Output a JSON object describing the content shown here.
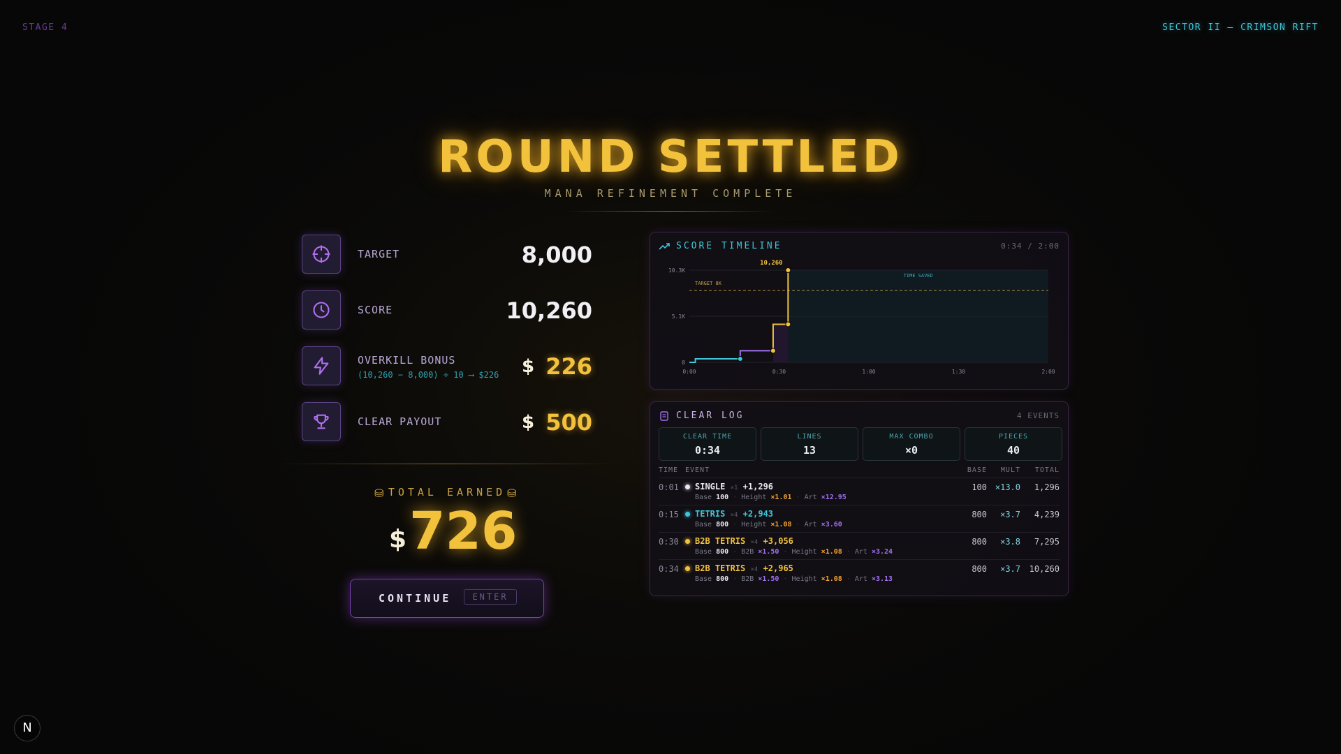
{
  "header": {
    "stage": "STAGE 4",
    "sector": "SECTOR II — CRIMSON RIFT"
  },
  "title": "ROUND SETTLED",
  "subtitle": "MANA REFINEMENT COMPLETE",
  "stats": {
    "target": {
      "label": "TARGET",
      "value": "8,000",
      "icon": "crosshair-icon"
    },
    "score": {
      "label": "SCORE",
      "value": "10,260",
      "icon": "clock-icon"
    },
    "overkill": {
      "label": "OVERKILL BONUS",
      "formula": "(10,260 − 8,000) ÷ 10 ⟶ $226",
      "currency": "$",
      "value": "226",
      "icon": "lightning-icon"
    },
    "payout": {
      "label": "CLEAR PAYOUT",
      "currency": "$",
      "value": "500",
      "icon": "trophy-icon"
    }
  },
  "total": {
    "label": "TOTAL EARNED",
    "currency": "$",
    "value": "726"
  },
  "continue": {
    "label": "CONTINUE",
    "key": "ENTER"
  },
  "timeline": {
    "title": "SCORE TIMELINE",
    "time": "0:34 / 2:00",
    "chart_data": {
      "type": "line",
      "x": [
        0,
        4,
        4,
        34,
        34,
        56,
        56,
        66,
        66
      ],
      "y": [
        0,
        0,
        384,
        384,
        1296,
        1296,
        4239,
        4239,
        10260
      ],
      "xticks": [
        "0:00",
        "0:30",
        "1:00",
        "1:30",
        "2:00"
      ],
      "yticks": [
        "0",
        "5.1K",
        "10.3K"
      ],
      "xlim": [
        0,
        240
      ],
      "ylim": [
        0,
        10260
      ],
      "target_line": {
        "value": 8000,
        "label": "TARGET 8K"
      },
      "peak_label": "10,260",
      "region_label": "TIME SAVED",
      "colors": {
        "line_early": "#3fc6d8",
        "line_mid": "#a070f0",
        "line_late": "#f2c23c",
        "target": "#b08a3a"
      }
    }
  },
  "clearlog": {
    "title": "CLEAR LOG",
    "count": "4 EVENTS",
    "summary": [
      {
        "label": "CLEAR TIME",
        "value": "0:34"
      },
      {
        "label": "LINES",
        "value": "13"
      },
      {
        "label": "MAX COMBO",
        "value": "×0"
      },
      {
        "label": "PIECES",
        "value": "40"
      }
    ],
    "columns": {
      "time": "TIME",
      "event": "EVENT",
      "base": "BASE",
      "mult": "MULT",
      "total": "TOTAL"
    },
    "rows": [
      {
        "time": "0:01",
        "name": "SINGLE",
        "lines": "×1",
        "gain": "+1,296",
        "color": "#e8e8f0",
        "sub": [
          [
            "Base",
            "100",
            "#e8e8f0"
          ],
          [
            "Height",
            "×1.01",
            "#f2a030"
          ],
          [
            "Art",
            "×12.95",
            "#a070f0"
          ]
        ],
        "base": "100",
        "mult": "×13.0",
        "total": "1,296"
      },
      {
        "time": "0:15",
        "name": "TETRIS",
        "lines": "×4",
        "gain": "+2,943",
        "color": "#3fc6d8",
        "sub": [
          [
            "Base",
            "800",
            "#e8e8f0"
          ],
          [
            "Height",
            "×1.08",
            "#f2a030"
          ],
          [
            "Art",
            "×3.60",
            "#a070f0"
          ]
        ],
        "base": "800",
        "mult": "×3.7",
        "total": "4,239"
      },
      {
        "time": "0:30",
        "name": "B2B TETRIS",
        "lines": "×4",
        "gain": "+3,056",
        "color": "#f2c23c",
        "sub": [
          [
            "Base",
            "800",
            "#e8e8f0"
          ],
          [
            "B2B",
            "×1.50",
            "#a070f0"
          ],
          [
            "Height",
            "×1.08",
            "#f2a030"
          ],
          [
            "Art",
            "×3.24",
            "#a070f0"
          ]
        ],
        "base": "800",
        "mult": "×3.8",
        "total": "7,295"
      },
      {
        "time": "0:34",
        "name": "B2B TETRIS",
        "lines": "×4",
        "gain": "+2,965",
        "color": "#f2c23c",
        "sub": [
          [
            "Base",
            "800",
            "#e8e8f0"
          ],
          [
            "B2B",
            "×1.50",
            "#a070f0"
          ],
          [
            "Height",
            "×1.08",
            "#f2a030"
          ],
          [
            "Art",
            "×3.13",
            "#a070f0"
          ]
        ],
        "base": "800",
        "mult": "×3.7",
        "total": "10,260"
      }
    ]
  },
  "footer": {
    "logo": "N"
  }
}
